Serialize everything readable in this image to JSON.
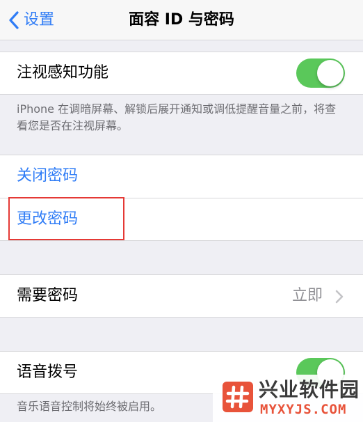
{
  "nav": {
    "back_label": "设置",
    "title": "面容 ID 与密码"
  },
  "attention": {
    "label": "注视感知功能",
    "enabled": true,
    "footnote": "iPhone 在调暗屏幕、解锁后展开通知或调低提醒音量之前，将查看您是否在注视屏幕。"
  },
  "passcode": {
    "turn_off_label": "关闭密码",
    "change_label": "更改密码"
  },
  "require_passcode": {
    "label": "需要密码",
    "value": "立即"
  },
  "voice_dial": {
    "label": "语音拨号",
    "enabled": true,
    "footnote": "音乐语音控制将始终被启用。"
  },
  "watermark": {
    "title": "兴业软件园",
    "subtitle": "MYXYJS.COM"
  },
  "colors": {
    "accent": "#2f7cf6",
    "toggle_on": "#5ac85a",
    "highlight": "#e53935",
    "watermark": "#e8533a"
  },
  "icons": {
    "back": "chevron-left-icon",
    "disclosure": "chevron-right-icon",
    "watermark_logo": "hash-logo-icon"
  }
}
